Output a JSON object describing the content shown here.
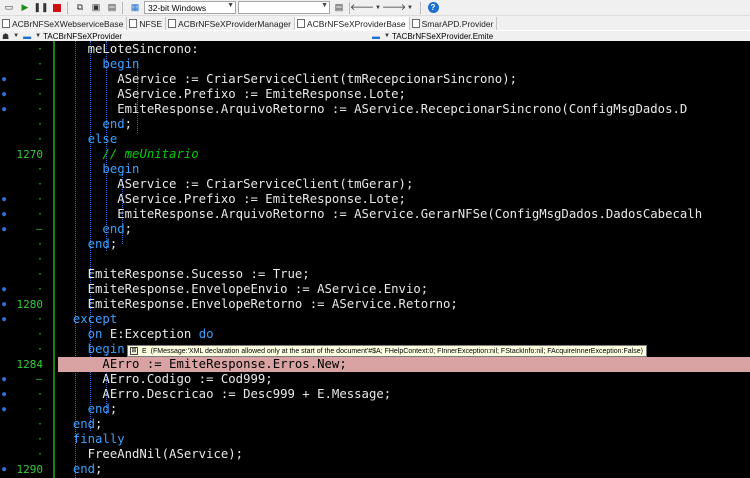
{
  "toolbar": {
    "platform_combo": "32-bit Windows",
    "empty_combo": "",
    "help_glyph": "?"
  },
  "tabs": [
    {
      "label": "ACBrNFSeXWebserviceBase"
    },
    {
      "label": "NFSE"
    },
    {
      "label": "ACBrNFSeXProviderManager"
    },
    {
      "label": "ACBrNFSeXProviderBase"
    },
    {
      "label": "SmarAPD.Provider"
    }
  ],
  "nav": {
    "class_selector": "TACBrNFSeXProvider",
    "method_selector": "TACBrNFSeXProvider.Emite"
  },
  "gutter_numbers": {
    "n1270": "1270",
    "n1280": "1280",
    "n1284": "1284",
    "n1290": "1290"
  },
  "code": [
    {
      "t": "    meLoteSincrono:"
    },
    {
      "t": "      begin"
    },
    {
      "t": "        AService := CriarServiceClient(tmRecepcionarSincrono);"
    },
    {
      "t": "        AService.Prefixo := EmiteResponse.Lote;"
    },
    {
      "t": "        EmiteResponse.ArquivoRetorno := AService.RecepcionarSincrono(ConfigMsgDados.D"
    },
    {
      "t": "      end;"
    },
    {
      "t": "    else"
    },
    {
      "t": "      // meUnitario"
    },
    {
      "t": "      begin"
    },
    {
      "t": "        AService := CriarServiceClient(tmGerar);"
    },
    {
      "t": "        AService.Prefixo := EmiteResponse.Lote;"
    },
    {
      "t": "        EmiteResponse.ArquivoRetorno := AService.GerarNFSe(ConfigMsgDados.DadosCabecalh"
    },
    {
      "t": "      end;"
    },
    {
      "t": "    end;"
    },
    {
      "t": ""
    },
    {
      "t": "    EmiteResponse.Sucesso := True;"
    },
    {
      "t": "    EmiteResponse.EnvelopeEnvio := AService.Envio;"
    },
    {
      "t": "    EmiteResponse.EnvelopeRetorno := AService.Retorno;"
    },
    {
      "t": "  except"
    },
    {
      "t": "    on E:Exception do"
    },
    {
      "t": "    begin"
    },
    {
      "t": "      AErro := EmiteResponse.Erros.New;"
    },
    {
      "t": "      AErro.Codigo := Cod999;"
    },
    {
      "t": "      AErro.Descricao := Desc999 + E.Message;"
    },
    {
      "t": "    end;"
    },
    {
      "t": "  end;"
    },
    {
      "t": "  finally"
    },
    {
      "t": "    FreeAndNil(AService);"
    },
    {
      "t": "  end;"
    }
  ],
  "tooltip": {
    "label": "E",
    "text": "(FMessage:'XML declaration allowed only at the start of the document'#$A; FHelpContext:0; FInnerException:nil; FStackInfo:nil; FAcquireInnerException:False)"
  },
  "colors": {
    "editor_bg": "#000000",
    "keyword": "#3aa0ff",
    "comment": "#00cc00",
    "line_number": "#2ecc2e",
    "execution_line_bg": "#d9a3a3",
    "breakpoint": "#2f6fe0",
    "active_tab_underline": "#e81123"
  }
}
